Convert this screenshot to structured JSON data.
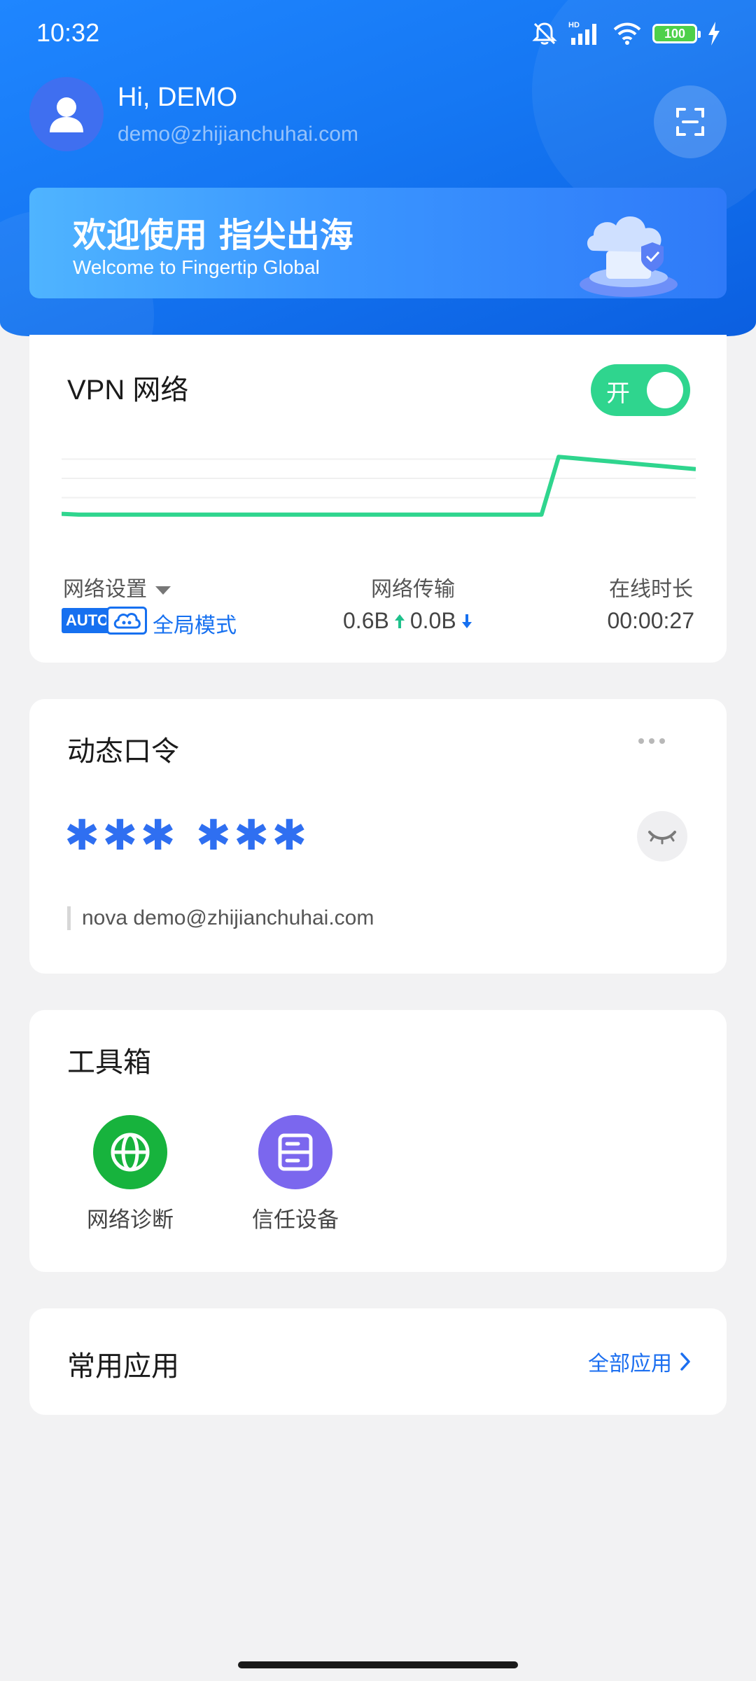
{
  "status_bar": {
    "time": "10:32",
    "battery": "100",
    "hd_label": "HD"
  },
  "user": {
    "greeting": "Hi, DEMO",
    "email": "demo@zhijianchuhai.com"
  },
  "banner": {
    "title": "欢迎使用 指尖出海",
    "subtitle": "Welcome to Fingertip Global"
  },
  "vpn": {
    "title": "VPN 网络",
    "toggle_label": "开",
    "toggle_on": true,
    "network_settings_label": "网络设置",
    "mode_badge": "AUTO",
    "mode_text": "全局模式",
    "transfer_label": "网络传输",
    "upload": "0.6B",
    "download": "0.0B",
    "online_label": "在线时长",
    "online_time": "00:00:27"
  },
  "chart_data": {
    "type": "line",
    "series": [
      {
        "values": [
          4,
          3,
          3,
          3,
          3,
          3,
          3,
          3,
          3,
          3,
          3,
          3,
          3,
          3,
          3,
          3,
          3,
          3,
          3,
          3,
          3,
          3,
          3,
          3,
          3,
          3,
          3,
          3,
          3,
          78,
          76,
          74,
          72,
          70,
          68,
          66,
          64,
          62
        ]
      }
    ],
    "grid": true,
    "color": "#2fd58e"
  },
  "otp": {
    "title": "动态口令",
    "code_masked": "✱✱✱ ✱✱✱",
    "account": "nova demo@zhijianchuhai.com"
  },
  "toolbox": {
    "title": "工具箱",
    "items": [
      {
        "label": "网络诊断",
        "color": "#17b33d",
        "icon": "globe-icon"
      },
      {
        "label": "信任设备",
        "color": "#7b67ee",
        "icon": "server-icon"
      }
    ]
  },
  "apps": {
    "title": "常用应用",
    "all_apps_label": "全部应用"
  },
  "colors": {
    "primary": "#1670f0",
    "accent_green": "#2fd58e"
  }
}
